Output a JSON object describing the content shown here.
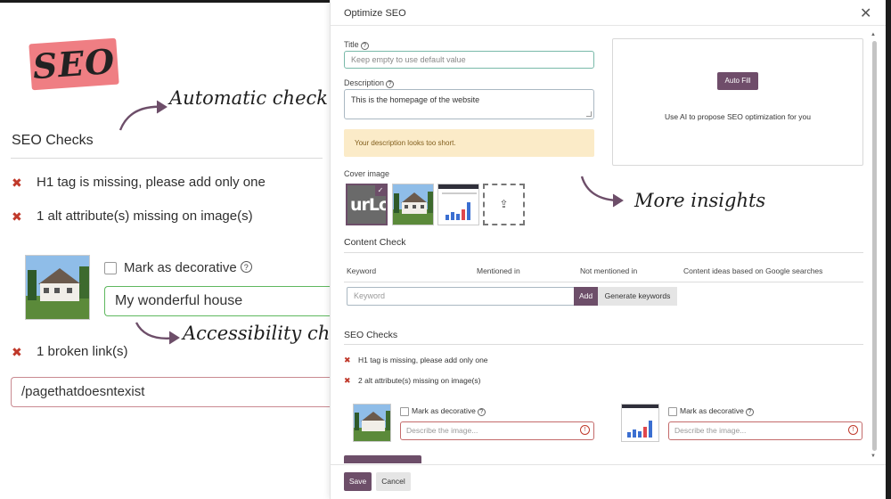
{
  "left_panel": {
    "badge": "SEO",
    "annotations": {
      "automatic": "Automatic check",
      "accessibility": "Accessibility checks",
      "insights": "More insights"
    },
    "title": "SEO Checks",
    "checks": [
      "H1 tag is missing, please add only one",
      "1 alt attribute(s) missing on image(s)"
    ],
    "mark_decorative": "Mark as decorative",
    "alt_value": "My wonderful house",
    "broken_links": "1 broken link(s)",
    "link_value": "/pagethatdoesntexist"
  },
  "modal": {
    "title": "Optimize SEO",
    "title_label": "Title",
    "title_placeholder": "Keep empty to use default value",
    "description_label": "Description",
    "description_value": "This is the homepage of the website",
    "warning": "Your description looks too short.",
    "autofill_button": "Auto Fill",
    "autofill_text": "Use AI to propose SEO optimization for you",
    "cover_label": "Cover image",
    "cover_logo_text": "urLo",
    "content_check_title": "Content Check",
    "columns": [
      "Keyword",
      "Mentioned in",
      "Not mentioned in",
      "Content ideas based on Google searches"
    ],
    "keyword_placeholder": "Keyword",
    "add_button": "Add",
    "generate_button": "Generate keywords",
    "seo_checks_title": "SEO Checks",
    "checks": [
      "H1 tag is missing, please add only one",
      "2 alt attribute(s) missing on image(s)"
    ],
    "mark_decorative": "Mark as decorative",
    "alt_placeholder": "Describe the image...",
    "save_button": "Save",
    "cancel_button": "Cancel"
  },
  "colors": {
    "accent": "#6d4e69",
    "error": "#c0392b",
    "warning_bg": "#fbebc8",
    "badge": "#ef7e83",
    "valid_border": "#5fb85f"
  },
  "icons": {
    "close": "close-icon",
    "error": "x-mark-icon",
    "help": "question-circle-icon",
    "upload": "upload-icon"
  }
}
